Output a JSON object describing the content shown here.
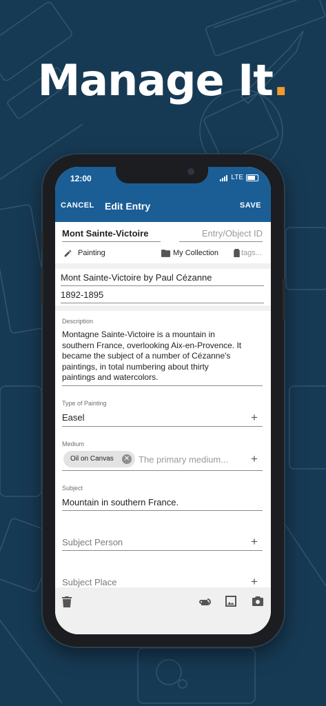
{
  "headline": {
    "text": "Manage It",
    "dot": "."
  },
  "status_bar": {
    "time": "12:00",
    "network": "LTE"
  },
  "app_bar": {
    "cancel_label": "CANCEL",
    "title": "Edit Entry",
    "save_label": "SAVE"
  },
  "entry": {
    "name": "Mont Sainte-Victoire",
    "id_placeholder": "Entry/Object ID",
    "type": "Painting",
    "collection": "My Collection",
    "tags_placeholder": "tags...",
    "full_title": "Mont Sainte-Victoire by Paul Cézanne",
    "date": "1892-1895"
  },
  "description": {
    "label": "Description",
    "lines": [
      "Montagne Sainte-Victoire is a mountain in",
      "southern France, overlooking Aix-en-Provence. It",
      "became the subject of a number of Cézanne's",
      "paintings, in total numbering about thirty",
      "paintings and watercolors."
    ]
  },
  "type_of_painting": {
    "label": "Type of Painting",
    "value": "Easel"
  },
  "medium": {
    "label": "Medium",
    "chip": "Oil on Canvas",
    "placeholder": "The primary medium..."
  },
  "subject": {
    "label": "Subject",
    "value": "Mountain in southern France."
  },
  "subject_person": {
    "placeholder": "Subject Person"
  },
  "subject_place": {
    "placeholder": "Subject Place"
  },
  "colors": {
    "primary": "#1b5e96",
    "background": "#173a54",
    "accent": "#f29a2e"
  },
  "bottom_icons": [
    "trash-icon",
    "paperclip-icon",
    "image-icon",
    "camera-icon"
  ]
}
